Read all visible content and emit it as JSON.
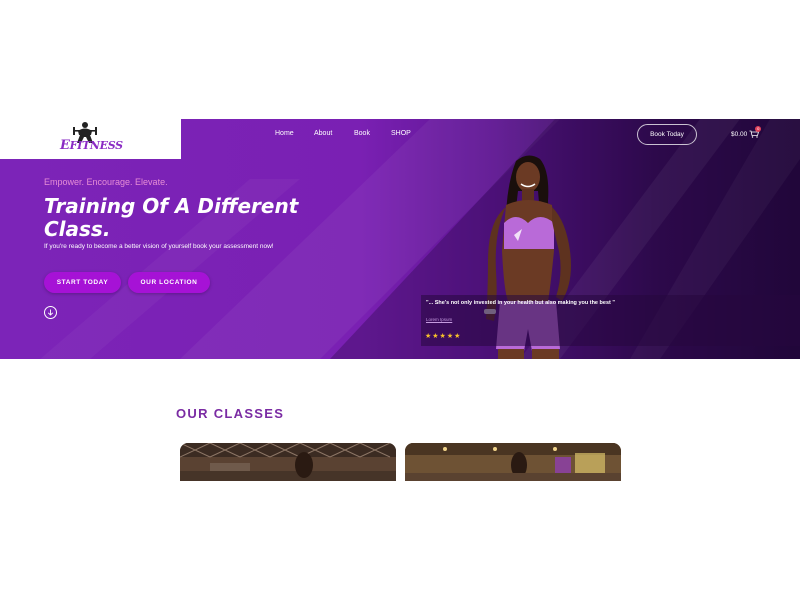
{
  "header": {
    "logo_text_prefix": "E",
    "logo_text_main": "FITNESS",
    "nav": [
      {
        "label": "Home"
      },
      {
        "label": "About"
      },
      {
        "label": "Book"
      },
      {
        "label": "SHOP"
      }
    ],
    "book_button": "Book Today",
    "cart_total": "$0.00",
    "cart_count": "0"
  },
  "hero": {
    "tagline": "Empower. Encourage. Elevate.",
    "headline_line1": "Training Of A Different",
    "headline_line2": "Class.",
    "subtext": "If you're ready to become a better vision of yourself book your assessment now!",
    "start_button": "START TODAY",
    "location_button": "OUR LOCATION",
    "testimonial": {
      "quote": "\"... She's not only invested in your health but also making you the best \"",
      "author": "Lorem Ipsum",
      "stars": "★★★★★",
      "rating": 5
    }
  },
  "classes": {
    "title": "OUR CLASSES"
  },
  "colors": {
    "brand_purple": "#7c24b8",
    "button_purple": "#a612d6",
    "section_title": "#7a2ba3",
    "tagline_pink": "#e68dd6",
    "star_gold": "#f7c12a"
  }
}
